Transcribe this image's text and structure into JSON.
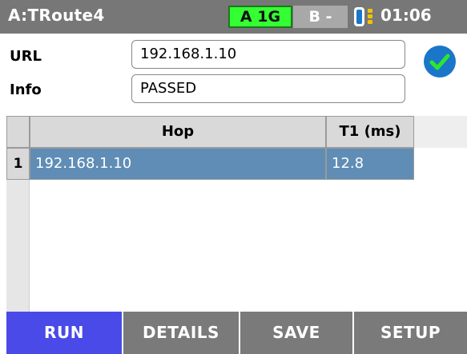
{
  "titlebar": {
    "title": "A:TRoute4",
    "port_a": "A 1G",
    "port_b": "B -",
    "port_a_color": "#33ff33",
    "phone_icon": "phone-battery-icon",
    "time": "01:06"
  },
  "fields": {
    "url_label": "URL",
    "url_value": "192.168.1.10",
    "info_label": "Info",
    "info_value": "PASSED",
    "status_icon": "check-circle-icon",
    "status_color": "#1a76c8"
  },
  "table": {
    "columns": [
      "Hop",
      "T1 (ms)"
    ],
    "rows": [
      {
        "index": "1",
        "hop": "192.168.1.10",
        "t1": "12.8"
      }
    ],
    "selected_row_color": "#5f8db6"
  },
  "buttons": {
    "run": "RUN",
    "details": "DETAILS",
    "save": "SAVE",
    "setup": "SETUP",
    "run_color": "#4a4ae8"
  }
}
